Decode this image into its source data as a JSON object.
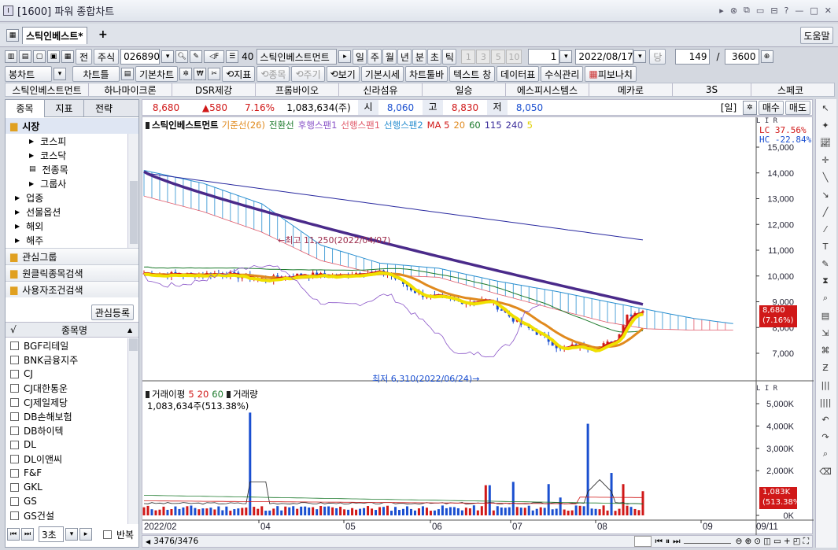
{
  "window": {
    "title": "[1600] 파워 종합차트"
  },
  "tabs": {
    "active": "스틱인베스트*",
    "add": "+"
  },
  "help": "도움말",
  "toolbar1": {
    "jeon": "전",
    "juesik": "주식",
    "code": "026890",
    "size40": "40",
    "name": "스틱인베스트먼트",
    "periods": [
      "일",
      "주",
      "월",
      "년",
      "분",
      "초",
      "틱"
    ],
    "nums": [
      "1",
      "3",
      "5",
      "10"
    ],
    "unit": "1",
    "date": "2022/08/17",
    "dang": "당",
    "count": "149",
    "slash": "/",
    "total": "3600"
  },
  "toolbar2": {
    "items": [
      "봉차트",
      "차트틀",
      "기본차트",
      "지표",
      "종목",
      "주기",
      "보기",
      "기본시세",
      "차트툴바",
      "텍스트 창",
      "데이터표",
      "수식관리",
      "피보나치"
    ]
  },
  "shortcuts": [
    "스틱인베스트먼트",
    "하나마이크론",
    "DSR제강",
    "프롬바이오",
    "신라섬유",
    "일승",
    "에스피시스템스",
    "메카로",
    "3S",
    "스페코"
  ],
  "left": {
    "tabs": [
      "종목",
      "지표",
      "전략"
    ],
    "market": "시장",
    "tree": [
      "코스피",
      "코스닥",
      "전종목",
      "그룹사",
      "업종",
      "선물옵션",
      "해외",
      "해주"
    ],
    "groups": [
      "관심그룹",
      "원클릭종목검색",
      "사용자조건검색"
    ],
    "reg": "관심등록",
    "col": "종목명",
    "checkmark": "√",
    "stocks": [
      "BGF리테일",
      "BNK금융지주",
      "CJ",
      "CJ대한통운",
      "CJ제일제당",
      "DB손해보험",
      "DB하이텍",
      "DL",
      "DL이앤씨",
      "F&F",
      "GKL",
      "GS",
      "GS건설"
    ],
    "bottom": {
      "sel": "3초",
      "repeat": "반복"
    }
  },
  "quote": {
    "price": "8,680",
    "change": "▲580",
    "pct": "7.16%",
    "volume": "1,083,634(주)",
    "open_l": "시",
    "open": "8,060",
    "high_l": "고",
    "high": "8,830",
    "low_l": "저",
    "low": "8,050",
    "period": "[일]",
    "buy": "매수",
    "sell": "매도"
  },
  "legend": {
    "name": "스틱인베스트먼트",
    "items": [
      {
        "t": "기준선(26)",
        "c": "#e08a1e"
      },
      {
        "t": "전환선",
        "c": "#1c7a2c"
      },
      {
        "t": "후행스팬1",
        "c": "#8a55c8"
      },
      {
        "t": "선행스팬1",
        "c": "#e05a6a"
      },
      {
        "t": "선행스팬2",
        "c": "#2a8fd0"
      },
      {
        "t": "MA 5",
        "c": "#d01818"
      },
      {
        "t": "20",
        "c": "#e08a1e"
      },
      {
        "t": "60",
        "c": "#1c7a2c"
      },
      {
        "t": "115",
        "c": "#3a2c9a"
      },
      {
        "t": "240",
        "c": "#3a2c9a"
      },
      {
        "t": "5",
        "c": "#e0d000"
      }
    ]
  },
  "pricelc": "LC  37.56%",
  "pricehc": "HC -22.84%",
  "yprice": [
    "15,000",
    "14,000",
    "13,000",
    "12,000",
    "11,000",
    "10,000",
    "9,000",
    "8,000",
    "7,000"
  ],
  "tag_price": "8,680",
  "tag_pct": "(7.16%)",
  "ann_high": "←최고 11,250(2022/04/07)",
  "ann_low": "최저 6,310(2022/06/24)→",
  "vol": {
    "legend": "거래이평",
    "ma": [
      {
        "t": "5",
        "c": "#d01818"
      },
      {
        "t": "20",
        "c": "#d01818"
      },
      {
        "t": "60",
        "c": "#1c7a2c"
      }
    ],
    "name": "거래량",
    "value": "1,083,634주(513.38%)",
    "yticks": [
      "5,000K",
      "4,000K",
      "3,000K",
      "2,000K",
      "0K"
    ],
    "tag1": "1,083K",
    "tag2": "(513.38%)"
  },
  "xaxis": [
    "2022/02",
    "04",
    "05",
    "06",
    "07",
    "08",
    "09",
    "09/11"
  ],
  "scroll": "3476/3476",
  "lir": "L I R",
  "colors": {
    "up": "#d01818",
    "down": "#1a4fd0",
    "cloud": "#2a8fd0",
    "ma115": "#4a2a8a"
  }
}
